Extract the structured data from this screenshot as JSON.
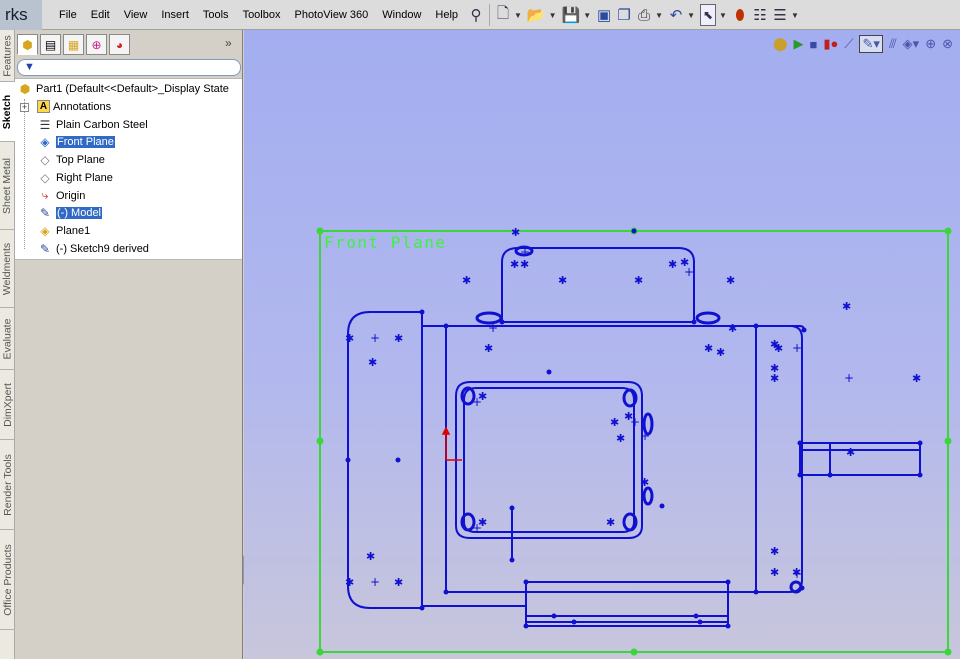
{
  "app": {
    "title_fragment": "rks"
  },
  "menu": [
    "File",
    "Edit",
    "View",
    "Insert",
    "Tools",
    "Toolbox",
    "PhotoView 360",
    "Window",
    "Help"
  ],
  "toolbar_icons": [
    "pin-icon",
    "new-document-icon",
    "open-folder-icon",
    "save-icon",
    "print-preview-icon",
    "copy-icon",
    "print-icon",
    "undo-icon",
    "select-arrow-icon",
    "rebuild-traffic-light-icon",
    "options-icon",
    "customize-icon"
  ],
  "vertical_tabs": [
    "Features",
    "Sketch",
    "Sheet Metal",
    "Weldments",
    "Evaluate",
    "DimXpert",
    "Render Tools",
    "Office Products"
  ],
  "active_vertical_tab": "Sketch",
  "feature_manager": {
    "tabs": [
      "feature-manager-tab",
      "property-manager-tab",
      "configuration-manager-tab",
      "dimxpert-manager-tab",
      "display-manager-tab"
    ],
    "more_glyph": "»",
    "tree": [
      {
        "label": "Part1  (Default<<Default>_Display State",
        "icon": "part-icon"
      },
      {
        "label": "Annotations",
        "icon": "annotations-icon"
      },
      {
        "label": "Plain Carbon Steel",
        "icon": "material-icon"
      },
      {
        "label": "Front Plane",
        "icon": "plane-icon",
        "selected": true
      },
      {
        "label": "Top Plane",
        "icon": "plane-icon"
      },
      {
        "label": "Right Plane",
        "icon": "plane-icon"
      },
      {
        "label": "Origin",
        "icon": "origin-icon"
      },
      {
        "label": "(-) Model",
        "icon": "sketch-icon",
        "selected": true
      },
      {
        "label": "Plane1",
        "icon": "plane-icon"
      },
      {
        "label": "(-) Sketch9 derived",
        "icon": "sketch-icon"
      }
    ]
  },
  "viewport": {
    "plane_label": "Front Plane",
    "view_icons": [
      "camera-icon",
      "play-icon",
      "stop-icon",
      "record-icon",
      "edit-sketch-icon",
      "sketch-view-icon",
      "display-style-icon",
      "view-orientation-icon",
      "zoom-to-fit-icon",
      "zoom-area-icon"
    ]
  },
  "colors": {
    "sketch": "#1010d0",
    "plane": "#3ad63a",
    "origin": "#e00000",
    "selection": "#316ac5"
  }
}
